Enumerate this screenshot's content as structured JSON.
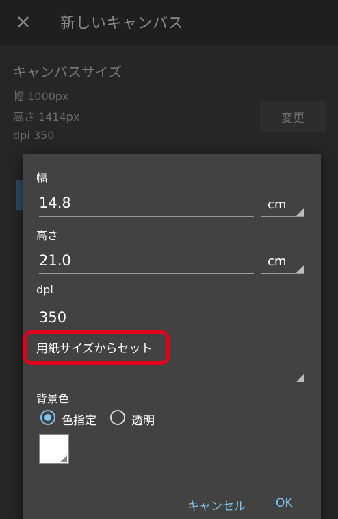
{
  "appbar": {
    "title": "新しいキャンバス",
    "close_icon": "close-icon"
  },
  "background": {
    "section_title": "キャンバスサイズ",
    "width_line": "幅 1000px",
    "height_line": "高さ 1414px",
    "dpi_line": "dpi 350",
    "change_label": "変更"
  },
  "dialog": {
    "width": {
      "label": "幅",
      "value": "14.8",
      "unit": "cm"
    },
    "height": {
      "label": "高さ",
      "value": "21.0",
      "unit": "cm"
    },
    "dpi": {
      "label": "dpi",
      "value": "350"
    },
    "paper_set_label": "用紙サイズからセット",
    "background_color": {
      "label": "背景色",
      "option_specified": "色指定",
      "option_transparent": "透明",
      "selected": "色指定",
      "swatch_color": "#ffffff"
    },
    "cancel_label": "キャンセル",
    "ok_label": "OK"
  },
  "colors": {
    "accent": "#7fc4f0",
    "highlight": "#e3001b",
    "dialog_bg": "#424242"
  }
}
